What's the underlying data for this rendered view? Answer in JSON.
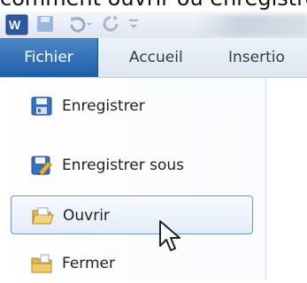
{
  "caption": "comment ouvrir ou enregistrer",
  "tabs": [
    {
      "label": "Fichier"
    },
    {
      "label": "Accueil"
    },
    {
      "label": "Insertio"
    }
  ],
  "menu": {
    "items": [
      {
        "label": "Enregistrer",
        "icon": "save-icon"
      },
      {
        "label": "Enregistrer sous",
        "icon": "save-as-icon"
      },
      {
        "label": "Ouvrir",
        "icon": "open-folder-icon"
      },
      {
        "label": "Fermer",
        "icon": "close-folder-icon"
      }
    ],
    "selected": "Ouvrir"
  },
  "colors": {
    "active_tab": "#2b6cb3",
    "selection_border": "#6f92c4",
    "word_blue": "#2c5aa0"
  }
}
